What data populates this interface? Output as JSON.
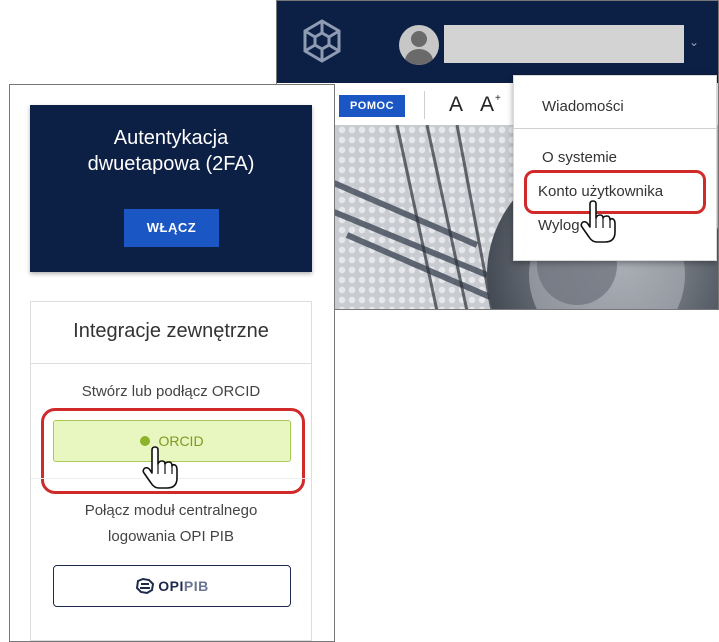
{
  "top_panel": {
    "help_button": "POMOC",
    "font_small": "A",
    "font_large": "A",
    "font_large_plus": "+",
    "dropdown_chevron": "⌄",
    "menu": {
      "item_messages": "Wiadomości",
      "item_about": "O systemie",
      "item_account": "Konto użytkownika",
      "item_logout": "Wylog"
    }
  },
  "left_panel": {
    "twofa": {
      "title_line1": "Autentykacja",
      "title_line2": "dwuetapowa (2FA)",
      "enable_button": "WŁĄCZ"
    },
    "integrations": {
      "title": "Integracje zewnętrzne",
      "orcid_description": "Stwórz lub podłącz ORCID",
      "orcid_button": "ORCID",
      "opi_description_line1": "Połącz moduł centralnego",
      "opi_description_line2": "logowania OPI PIB",
      "opi_button_part1": "OPI",
      "opi_button_part2": "PIB"
    }
  },
  "icons": [
    "app-logo-icon",
    "user-avatar-icon",
    "chevron-down-icon",
    "orcid-icon",
    "opi-logo-icon",
    "hand-pointer-icon"
  ],
  "colors": {
    "navy": "#0c1f44",
    "primary_blue": "#1a56c4",
    "orcid_green": "#8cb32a",
    "highlight_red": "#d02a2a"
  }
}
